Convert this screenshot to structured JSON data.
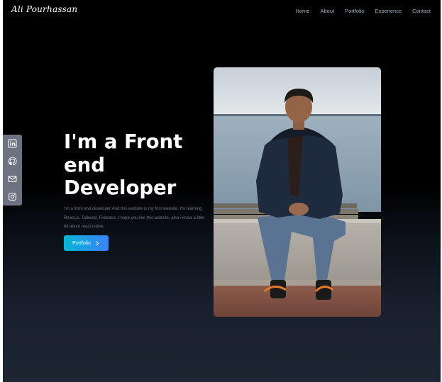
{
  "navbar": {
    "logo_text": "Ali Pourhassan",
    "links": [
      "Home",
      "About",
      "Portfolio",
      "Experience",
      "Contact"
    ]
  },
  "social": {
    "items": [
      {
        "icon": "linkedin-icon"
      },
      {
        "icon": "github-icon"
      },
      {
        "icon": "mail-icon"
      },
      {
        "icon": "instagram-icon"
      }
    ]
  },
  "hero": {
    "title_line1": "I'm a Front",
    "title_line2": "end",
    "title_line3": "Developer",
    "description": "I'm a front end developer And this website is my first website. I'm learning React.js, Tailwind, Firebase. I hope you like this website. also i know a little bit about react native.",
    "button_label": "Portfolio"
  },
  "colors": {
    "button_gradient_start": "#06b6d4",
    "button_gradient_end": "#3b82f6",
    "social_bar": "#6b7280"
  }
}
